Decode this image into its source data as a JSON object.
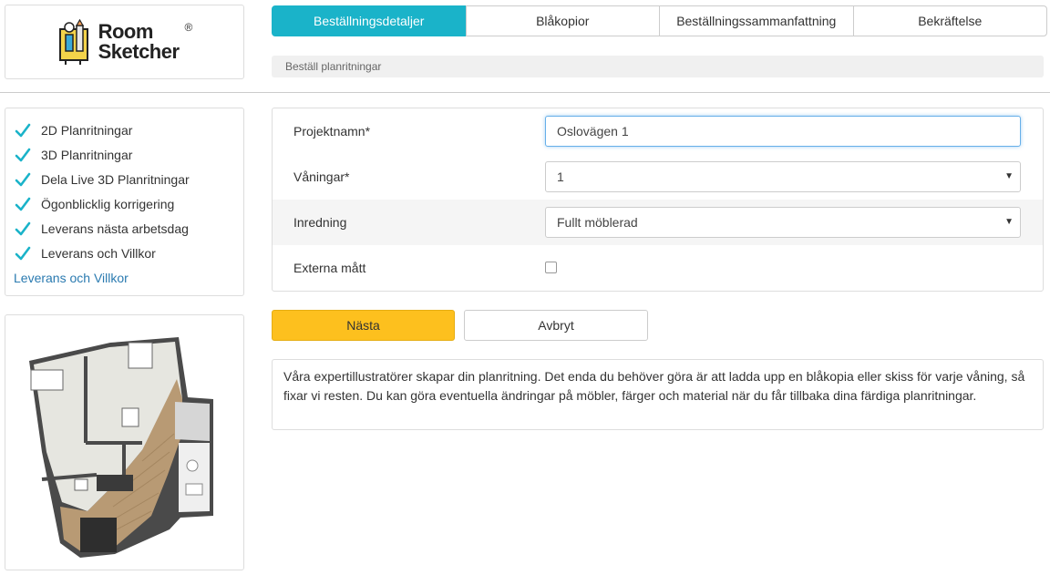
{
  "logo": {
    "line1": "Room",
    "line2": "Sketcher",
    "reg": "®"
  },
  "tabs": [
    {
      "label": "Beställningsdetaljer",
      "active": true
    },
    {
      "label": "Blåkopior",
      "active": false
    },
    {
      "label": "Beställningssammanfattning",
      "active": false
    },
    {
      "label": "Bekräftelse",
      "active": false
    }
  ],
  "breadcrumb": "Beställ planritningar",
  "features": [
    "2D Planritningar",
    "3D Planritningar",
    "Dela Live 3D Planritningar",
    "Ögonblicklig korrigering",
    "Leverans nästa arbetsdag",
    "Leverans och Villkor"
  ],
  "terms_link": "Leverans och Villkor",
  "form": {
    "project_label": "Projektnamn*",
    "project_value": "Oslovägen 1",
    "floors_label": "Våningar*",
    "floors_value": "1",
    "furnishing_label": "Inredning",
    "furnishing_value": "Fullt möblerad",
    "external_label": "Externa mått",
    "external_checked": false
  },
  "buttons": {
    "next": "Nästa",
    "cancel": "Avbryt"
  },
  "info_text": "Våra expertillustratörer skapar din planritning. Det enda du behöver göra är att ladda upp en blåkopia eller skiss för varje våning, så fixar vi resten. Du kan göra eventuella ändringar på möbler, färger och material när du får tillbaka dina färdiga planritningar.",
  "colors": {
    "accent": "#1ab3c9",
    "next_button": "#fdc01e",
    "check": "#1ab3c9",
    "link": "#2a7ab0"
  },
  "icons": {
    "feature": "check-icon",
    "select": "caret-down-icon"
  }
}
